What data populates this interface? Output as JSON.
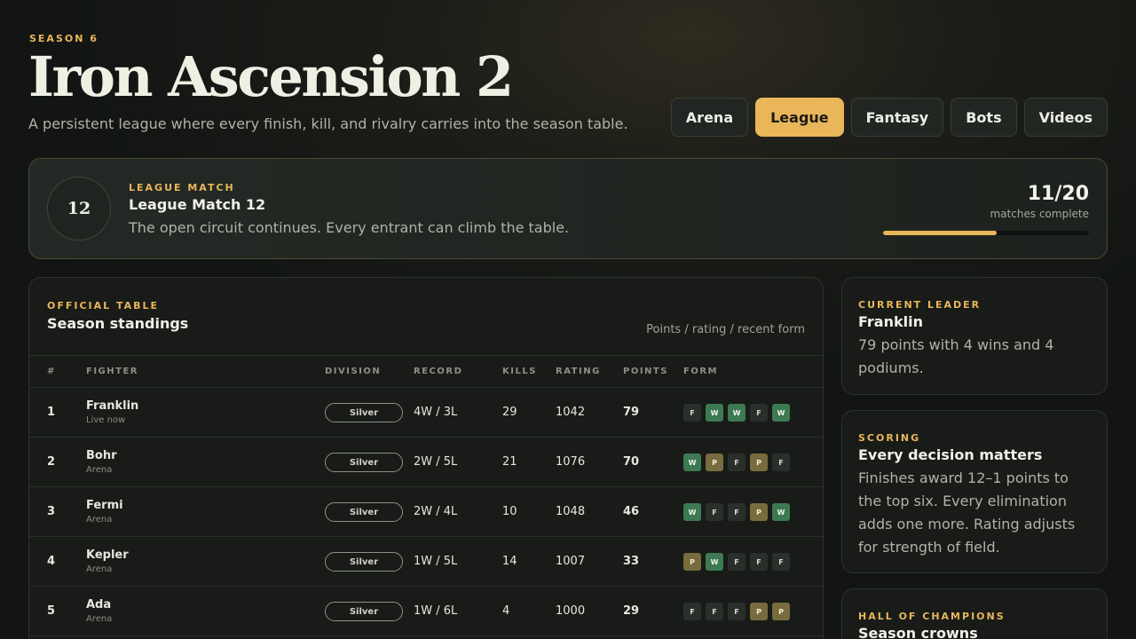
{
  "header": {
    "season": "SEASON 6",
    "title": "Iron Ascension 2",
    "subtitle": "A persistent league where every finish, kill, and rivalry carries into the season table."
  },
  "tabs": [
    {
      "label": "Arena",
      "active": false
    },
    {
      "label": "League",
      "active": true
    },
    {
      "label": "Fantasy",
      "active": false
    },
    {
      "label": "Bots",
      "active": false
    },
    {
      "label": "Videos",
      "active": false
    }
  ],
  "match": {
    "number": "12",
    "eyebrow": "LEAGUE MATCH",
    "title": "League Match 12",
    "description": "The open circuit continues. Every entrant can climb the table.",
    "progress_count": "11/20",
    "progress_label": "matches complete",
    "progress_fraction": 0.55
  },
  "standings": {
    "eyebrow": "OFFICIAL TABLE",
    "title": "Season standings",
    "note": "Points / rating / recent form",
    "columns": {
      "rank": "#",
      "fighter": "FIGHTER",
      "division": "DIVISION",
      "record": "RECORD",
      "kills": "KILLS",
      "rating": "RATING",
      "points": "POINTS",
      "form": "FORM"
    },
    "rows": [
      {
        "rank": "1",
        "name": "Franklin",
        "sub": "Live now",
        "division": "Silver",
        "record": "4W / 3L",
        "kills": "29",
        "rating": "1042",
        "points": "79",
        "form": [
          "F",
          "W",
          "W",
          "F",
          "W"
        ]
      },
      {
        "rank": "2",
        "name": "Bohr",
        "sub": "Arena",
        "division": "Silver",
        "record": "2W / 5L",
        "kills": "21",
        "rating": "1076",
        "points": "70",
        "form": [
          "W",
          "P",
          "F",
          "P",
          "F"
        ]
      },
      {
        "rank": "3",
        "name": "Fermi",
        "sub": "Arena",
        "division": "Silver",
        "record": "2W / 4L",
        "kills": "10",
        "rating": "1048",
        "points": "46",
        "form": [
          "W",
          "F",
          "F",
          "P",
          "W"
        ]
      },
      {
        "rank": "4",
        "name": "Kepler",
        "sub": "Arena",
        "division": "Silver",
        "record": "1W / 5L",
        "kills": "14",
        "rating": "1007",
        "points": "33",
        "form": [
          "P",
          "W",
          "F",
          "F",
          "F"
        ]
      },
      {
        "rank": "5",
        "name": "Ada",
        "sub": "Arena",
        "division": "Silver",
        "record": "1W / 6L",
        "kills": "4",
        "rating": "1000",
        "points": "29",
        "form": [
          "F",
          "F",
          "F",
          "P",
          "P"
        ]
      }
    ]
  },
  "leader": {
    "eyebrow": "CURRENT LEADER",
    "title": "Franklin",
    "body": "79 points with 4 wins and 4 podiums."
  },
  "scoring": {
    "eyebrow": "SCORING",
    "title": "Every decision matters",
    "body": "Finishes award 12–1 points to the top six. Every elimination adds one more. Rating adjusts for strength of field."
  },
  "champions": {
    "eyebrow": "HALL OF CHAMPIONS",
    "title": "Season crowns"
  },
  "colors": {
    "accent": "#e9b65a",
    "win": "#3d7a52",
    "podium": "#786b3e",
    "finish": "#2b2f2b"
  }
}
